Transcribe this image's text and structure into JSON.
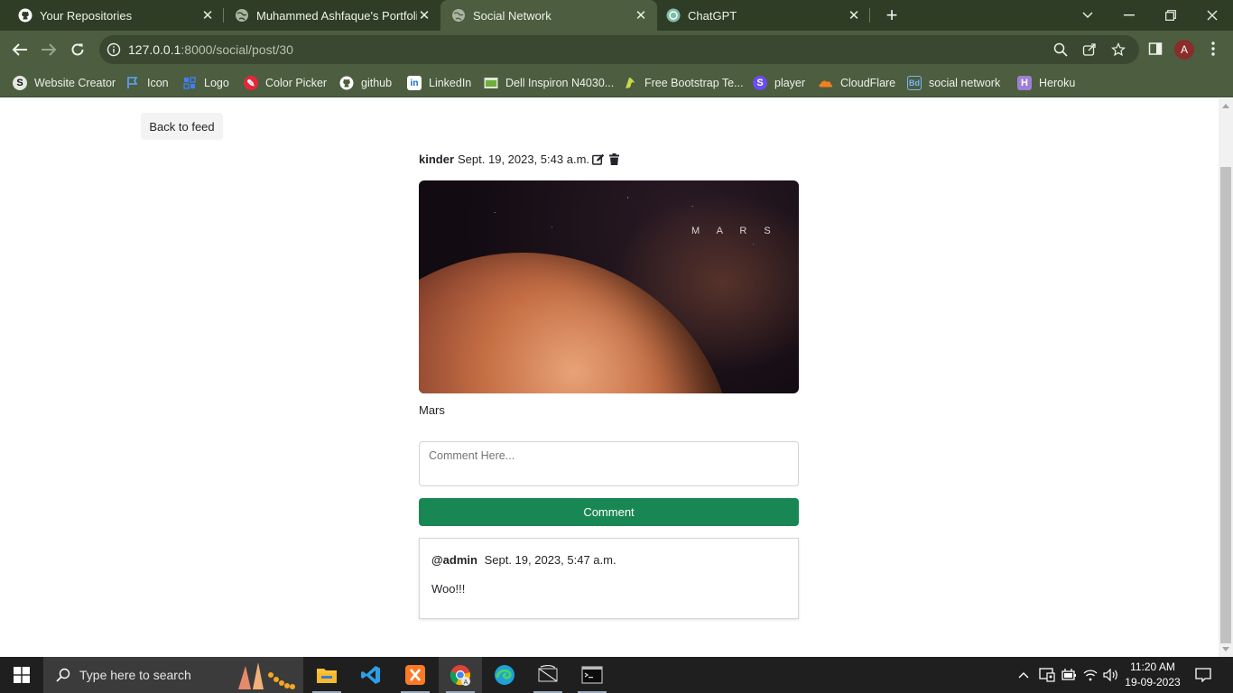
{
  "browser": {
    "tabs": [
      {
        "title": "Your Repositories",
        "icon": "github-icon"
      },
      {
        "title": "Muhammed Ashfaque's Portfolio",
        "icon": "globe-icon"
      },
      {
        "title": "Social Network",
        "icon": "globe-icon",
        "active": true
      },
      {
        "title": "ChatGPT",
        "icon": "chatgpt-icon"
      }
    ],
    "url_host": "127.0.0.1",
    "url_path": ":8000/social/post/30",
    "profile_initial": "A",
    "bookmarks": [
      {
        "label": "Website Creator",
        "icon": "website-creator-icon"
      },
      {
        "label": "Icon",
        "icon": "flag-icon"
      },
      {
        "label": "Logo",
        "icon": "logo-icon"
      },
      {
        "label": "Color Picker",
        "icon": "color-picker-icon"
      },
      {
        "label": "github",
        "icon": "github-icon"
      },
      {
        "label": "LinkedIn",
        "icon": "linkedin-icon"
      },
      {
        "label": "Dell Inspiron N4030...",
        "icon": "dell-icon"
      },
      {
        "label": "Free  Bootstrap Te...",
        "icon": "bootstrap-icon"
      },
      {
        "label": "player",
        "icon": "player-icon"
      },
      {
        "label": "CloudFlare",
        "icon": "cloudflare-icon"
      },
      {
        "label": "social network",
        "icon": "bd-icon"
      },
      {
        "label": "Heroku",
        "icon": "heroku-icon"
      }
    ]
  },
  "page": {
    "back_label": "Back to feed",
    "post": {
      "author": "kinder",
      "timestamp": "Sept. 19, 2023, 5:43 a.m.",
      "image_text": "M A R S",
      "caption": "Mars"
    },
    "comment_form": {
      "placeholder": "Comment Here...",
      "button_label": "Comment"
    },
    "comments": [
      {
        "user": "@admin",
        "timestamp": "Sept. 19, 2023, 5:47 a.m.",
        "body": "Woo!!!"
      }
    ]
  },
  "taskbar": {
    "search_placeholder": "Type here to search",
    "time": "11:20 AM",
    "date": "19-09-2023"
  },
  "colors": {
    "chrome_frame": "#2f3d27",
    "chrome_toolbar": "#4d5d40",
    "comment_button": "#198754"
  }
}
